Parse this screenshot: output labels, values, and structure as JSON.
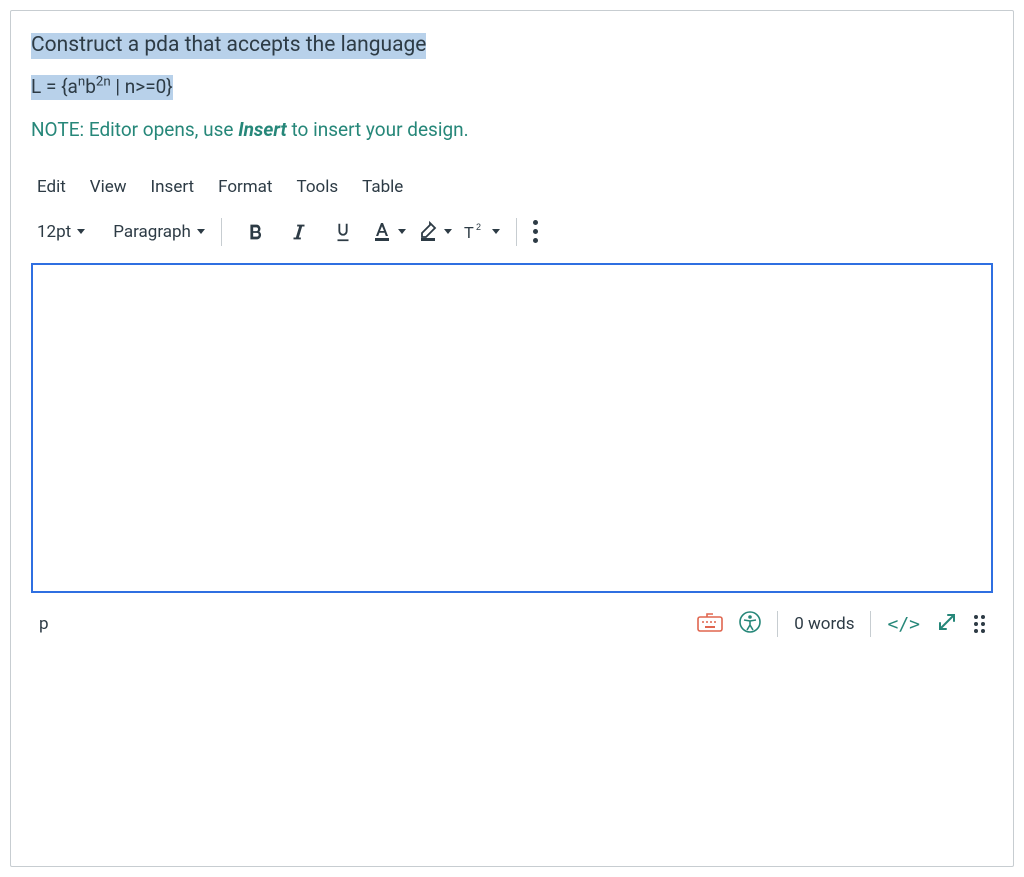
{
  "question": {
    "line1": "Construct a pda that accepts the language",
    "formula_prefix": "L = {a",
    "formula_sup1": "n",
    "formula_mid": "b",
    "formula_sup2": "2n",
    "formula_suffix": " | n>=0}",
    "note_prefix": "NOTE: Editor opens, use ",
    "note_insert": "Insert",
    "note_suffix": " to insert your design."
  },
  "editor": {
    "menu": {
      "edit": "Edit",
      "view": "View",
      "insert": "Insert",
      "format": "Format",
      "tools": "Tools",
      "table": "Table"
    },
    "toolbar": {
      "fontsize": "12pt",
      "blocktype": "Paragraph"
    },
    "status": {
      "path": "p",
      "words": "0 words",
      "code": "</>"
    }
  }
}
